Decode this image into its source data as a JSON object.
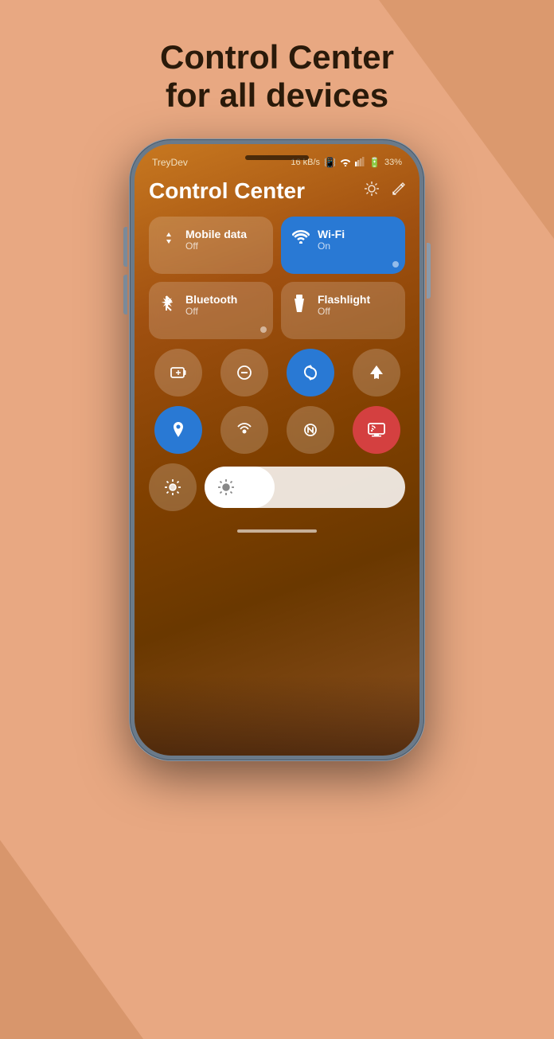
{
  "page": {
    "headline_line1": "Control Center",
    "headline_line2": "for all devices",
    "background_color": "#E8A882"
  },
  "status_bar": {
    "carrier": "TreyDev",
    "speed": "16 kB/s",
    "battery": "33%",
    "icons": "vibrate wifi signal battery"
  },
  "control_center": {
    "title": "Control Center",
    "header_icon1": "⊙",
    "header_icon2": "✎",
    "tiles": [
      {
        "id": "mobile-data",
        "name": "Mobile data",
        "status": "Off",
        "active": false,
        "icon": "↕"
      },
      {
        "id": "wifi",
        "name": "Wi-Fi",
        "status": "On",
        "active": true,
        "icon": "wifi"
      },
      {
        "id": "bluetooth",
        "name": "Bluetooth",
        "status": "Off",
        "active": false,
        "icon": "bluetooth"
      },
      {
        "id": "flashlight",
        "name": "Flashlight",
        "status": "Off",
        "active": false,
        "icon": "flashlight"
      }
    ],
    "round_buttons": [
      {
        "id": "battery-saver",
        "icon": "battery",
        "active": false,
        "label": "Battery saver"
      },
      {
        "id": "dnd",
        "icon": "dnd",
        "active": false,
        "label": "Do not disturb"
      },
      {
        "id": "rotate",
        "icon": "rotate",
        "active": true,
        "label": "Auto rotate"
      },
      {
        "id": "airplane",
        "icon": "airplane",
        "active": false,
        "label": "Airplane mode"
      },
      {
        "id": "location",
        "icon": "location",
        "active": true,
        "label": "Location"
      },
      {
        "id": "hotspot",
        "icon": "hotspot",
        "active": false,
        "label": "Hotspot"
      },
      {
        "id": "nfc",
        "icon": "nfc",
        "active": false,
        "label": "NFC"
      },
      {
        "id": "cast",
        "icon": "cast",
        "active": true,
        "label": "Cast",
        "active_red": true
      }
    ],
    "brightness": {
      "label": "Brightness",
      "value": 35
    }
  }
}
